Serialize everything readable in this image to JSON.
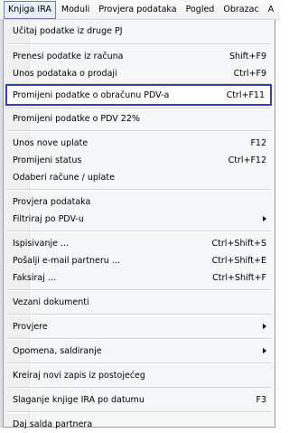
{
  "menubar": {
    "items": [
      "Knjiga IRA",
      "Moduli",
      "Provjera podataka",
      "Pogled",
      "Obrazac",
      "A"
    ]
  },
  "menu": {
    "items": [
      {
        "label": "Učitaj podatke iz druge PJ",
        "shortcut": ""
      },
      {
        "label": "Prenesi podatke iz računa",
        "shortcut": "Shift+F9"
      },
      {
        "label": "Unos podataka o prodaji",
        "shortcut": "Ctrl+F9"
      },
      {
        "label": "Promijeni podatke o obračunu PDV-a",
        "shortcut": "Ctrl+F11"
      },
      {
        "label": "Promijeni podatke o PDV 22%",
        "shortcut": ""
      },
      {
        "label": "Unos nove uplate",
        "shortcut": "F12"
      },
      {
        "label": "Promijeni status",
        "shortcut": "Ctrl+F12"
      },
      {
        "label": "Odaberi račune / uplate",
        "shortcut": ""
      },
      {
        "label": "Provjera podataka",
        "shortcut": ""
      },
      {
        "label": "Filtriraj po PDV-u",
        "shortcut": ""
      },
      {
        "label": "Ispisivanje ...",
        "shortcut": "Ctrl+Shift+S"
      },
      {
        "label": "Pošalji e-mail partneru ...",
        "shortcut": "Ctrl+Shift+E"
      },
      {
        "label": "Faksiraj ...",
        "shortcut": "Ctrl+Shift+F"
      },
      {
        "label": "Vezani dokumenti",
        "shortcut": ""
      },
      {
        "label": "Provjere",
        "shortcut": ""
      },
      {
        "label": "Opomena, saldiranje",
        "shortcut": ""
      },
      {
        "label": "Kreiraj novi zapis iz postojećeg",
        "shortcut": ""
      },
      {
        "label": "Slaganje knjige IRA po datumu",
        "shortcut": "F3"
      },
      {
        "label": "Daj salda partnera",
        "shortcut": ""
      }
    ]
  }
}
